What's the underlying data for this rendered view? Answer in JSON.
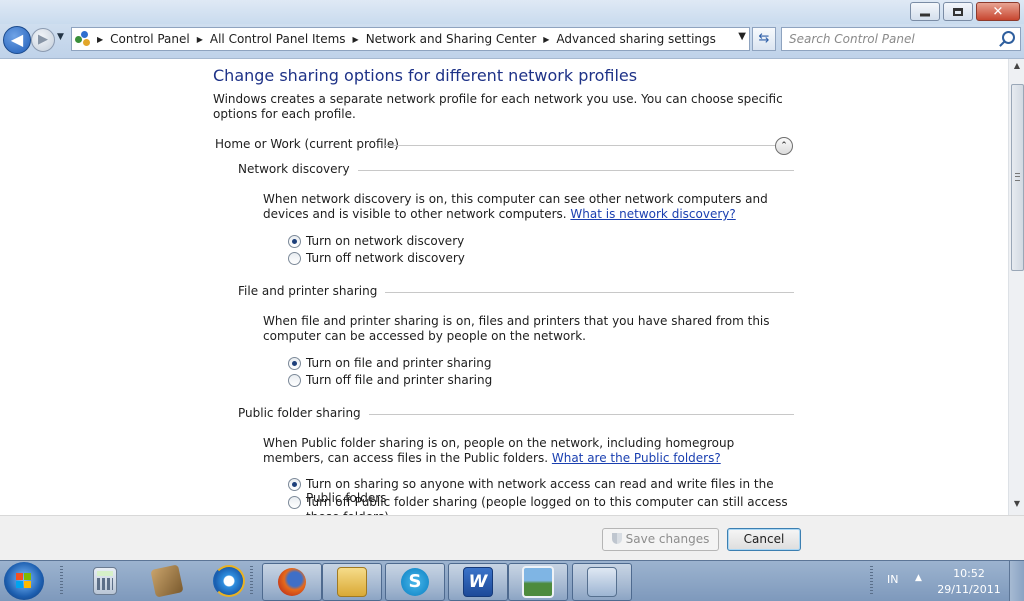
{
  "window": {
    "controls": {
      "minimize_icon": "minimize-icon",
      "maximize_icon": "restore-icon",
      "close_icon": "close-icon"
    }
  },
  "navbar": {
    "back_icon": "back-arrow-icon",
    "forward_icon": "forward-arrow-icon",
    "breadcrumbs": [
      "Control Panel",
      "All Control Panel Items",
      "Network and Sharing Center",
      "Advanced sharing settings"
    ],
    "search_placeholder": "Search Control Panel"
  },
  "main": {
    "title": "Change sharing options for different network profiles",
    "intro": "Windows creates a separate network profile for each network you use. You can choose specific options for each profile.",
    "profile_label": "Home or Work (current profile)",
    "sections": [
      {
        "heading": "Network discovery",
        "desc": "When network discovery is on, this computer can see other network computers and devices and is visible to other network computers.",
        "link": "What is network discovery?",
        "options": [
          {
            "label": "Turn on network discovery",
            "selected": true
          },
          {
            "label": "Turn off network discovery",
            "selected": false
          }
        ]
      },
      {
        "heading": "File and printer sharing",
        "desc": "When file and printer sharing is on, files and printers that you have shared from this computer can be accessed by people on the network.",
        "link": "",
        "options": [
          {
            "label": "Turn on file and printer sharing",
            "selected": true
          },
          {
            "label": "Turn off file and printer sharing",
            "selected": false
          }
        ]
      },
      {
        "heading": "Public folder sharing",
        "desc": "When Public folder sharing is on, people on the network, including homegroup members, can access files in the Public folders.",
        "link": "What are the Public folders?",
        "options": [
          {
            "label": "Turn on sharing so anyone with network access can read and write files in the Public folders",
            "selected": true
          },
          {
            "label": "Turn off Public folder sharing (people logged on to this computer can still access these folders)",
            "selected": false
          }
        ]
      }
    ]
  },
  "footer": {
    "save_label": "Save changes",
    "cancel_label": "Cancel"
  },
  "taskbar": {
    "apps": [
      {
        "name": "calculator-icon",
        "active": false
      },
      {
        "name": "address-book-icon",
        "active": false
      },
      {
        "name": "internet-explorer-icon",
        "active": false
      },
      {
        "name": "firefox-icon",
        "active": true
      },
      {
        "name": "windows-explorer-icon",
        "active": true
      },
      {
        "name": "skype-icon",
        "active": true
      },
      {
        "name": "word-icon",
        "active": true
      },
      {
        "name": "picture-viewer-icon",
        "active": true
      },
      {
        "name": "control-panel-icon",
        "active": true
      }
    ],
    "language": "IN",
    "time": "10:52",
    "date": "29/11/2011"
  }
}
